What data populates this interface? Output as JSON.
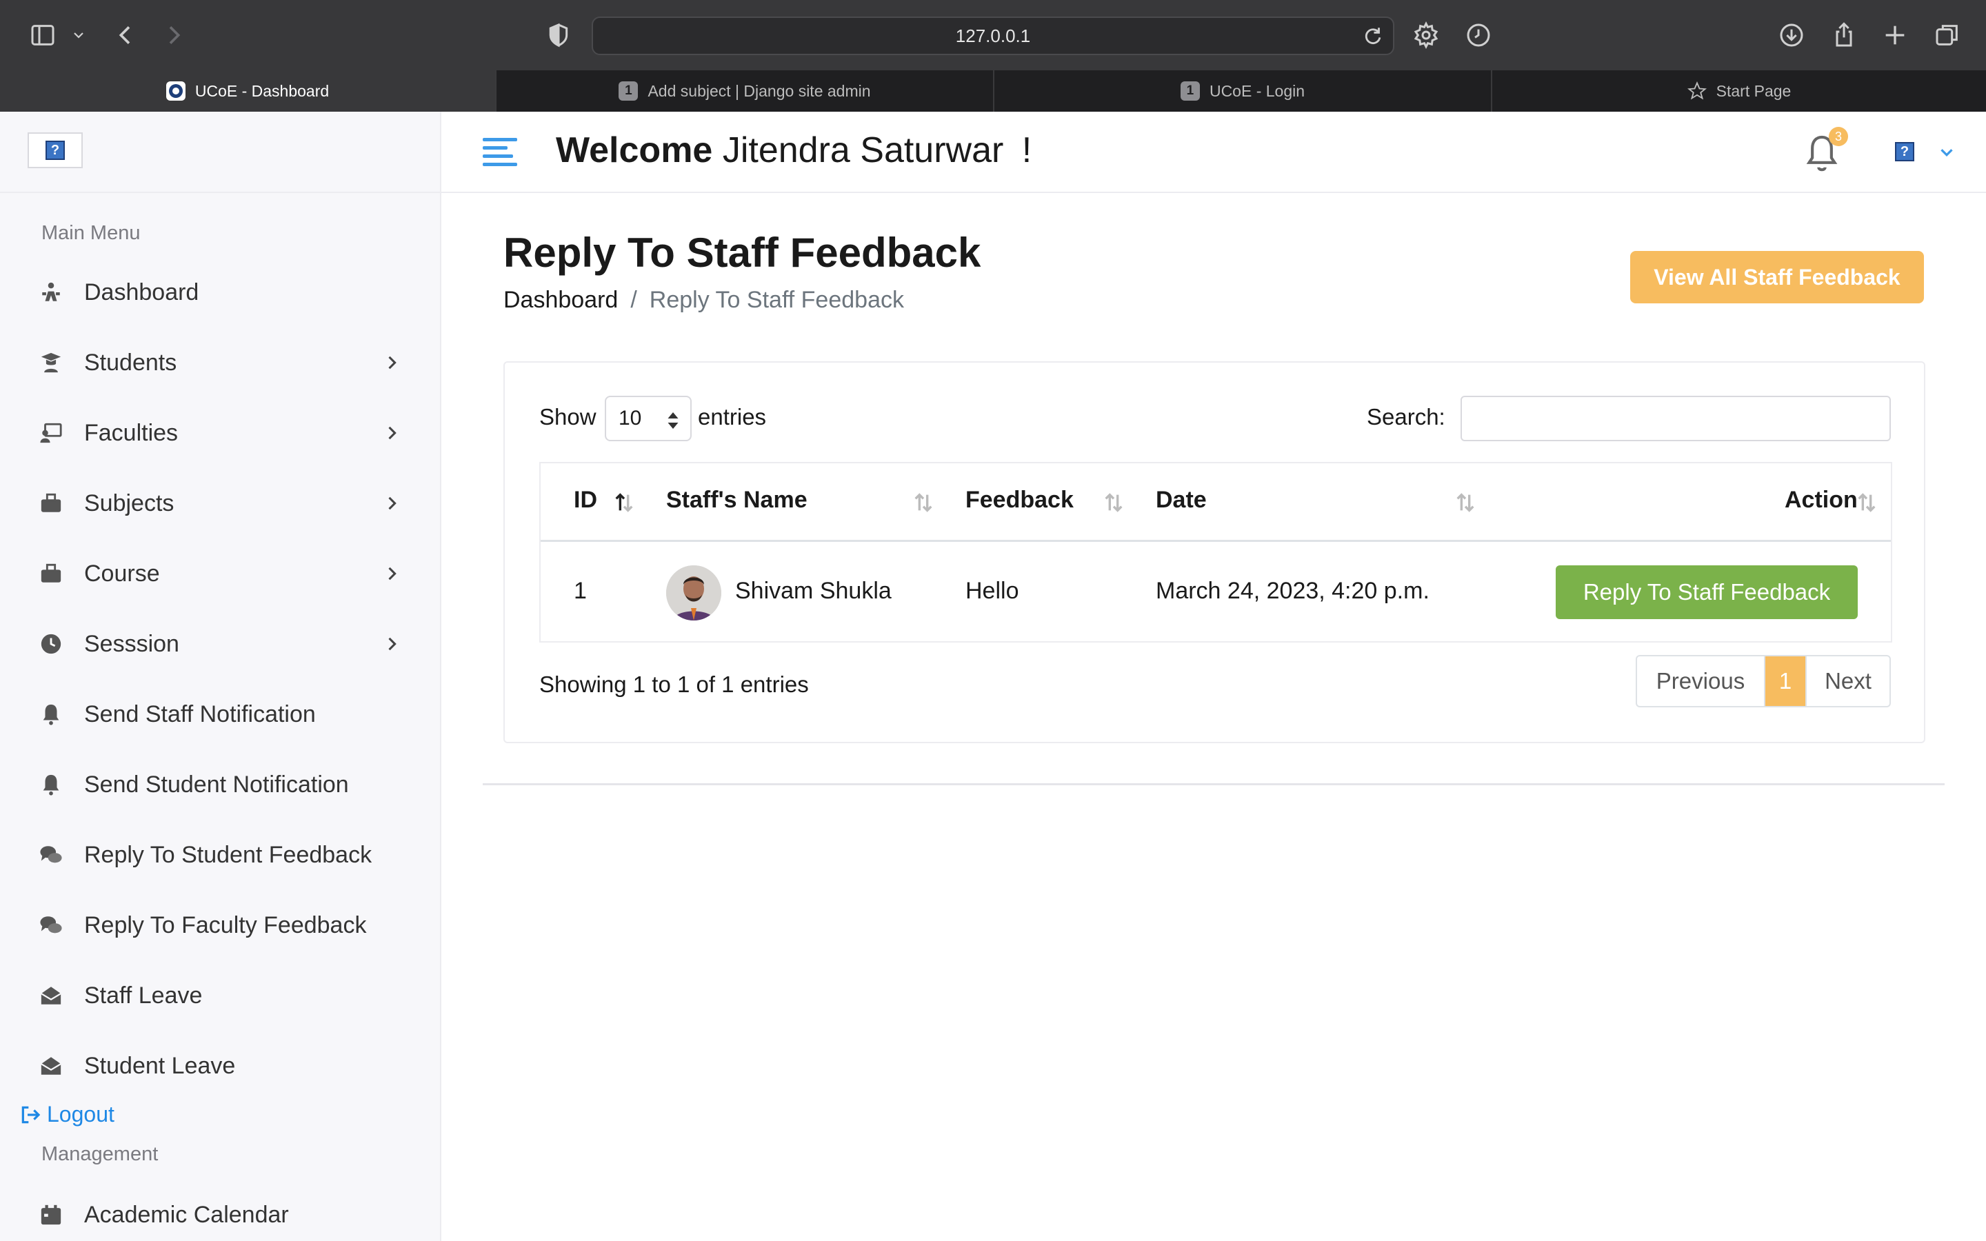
{
  "browser": {
    "url": "127.0.0.1",
    "tabs": [
      {
        "label": "UCoE - Dashboard",
        "icon": "college-logo-icon",
        "active": true
      },
      {
        "label": "Add subject | Django site admin",
        "icon_text": "1",
        "active": false
      },
      {
        "label": "UCoE - Login",
        "icon_text": "1",
        "active": false
      },
      {
        "label": "Start Page",
        "icon": "star-icon",
        "active": false
      }
    ]
  },
  "sidebar": {
    "logo_text": "?",
    "main_menu_title": "Main Menu",
    "items": [
      {
        "label": "Dashboard",
        "icon": "dashboard-icon",
        "has_submenu": false
      },
      {
        "label": "Students",
        "icon": "student-icon",
        "has_submenu": true
      },
      {
        "label": "Faculties",
        "icon": "faculty-icon",
        "has_submenu": true
      },
      {
        "label": "Subjects",
        "icon": "subjects-icon",
        "has_submenu": true
      },
      {
        "label": "Course",
        "icon": "course-icon",
        "has_submenu": true
      },
      {
        "label": "Sesssion",
        "icon": "clock-icon",
        "has_submenu": true
      },
      {
        "label": "Send Staff Notification",
        "icon": "bell-icon",
        "has_submenu": false
      },
      {
        "label": "Send Student Notification",
        "icon": "bell-icon",
        "has_submenu": false
      },
      {
        "label": "Reply To Student Feedback",
        "icon": "comments-icon",
        "has_submenu": false
      },
      {
        "label": "Reply To Faculty Feedback",
        "icon": "comments-icon",
        "has_submenu": false
      },
      {
        "label": "Staff Leave",
        "icon": "envelope-open-icon",
        "has_submenu": false
      },
      {
        "label": "Student Leave",
        "icon": "envelope-open-icon",
        "has_submenu": false
      }
    ],
    "logout_label": "Logout",
    "management_title": "Management",
    "management_items": [
      {
        "label": "Academic Calendar",
        "icon": "calendar-icon"
      }
    ]
  },
  "header": {
    "welcome_bold": "Welcome",
    "user_name": "Jitendra Saturwar",
    "exclamation": "!",
    "notification_count": "3",
    "avatar_text": "?"
  },
  "page": {
    "title": "Reply To Staff Feedback",
    "breadcrumb_home": "Dashboard",
    "breadcrumb_sep": "/",
    "breadcrumb_current": "Reply To Staff Feedback",
    "view_all_button": "View All Staff Feedback"
  },
  "table": {
    "show_label": "Show",
    "entries_value": "10",
    "entries_label": "entries",
    "search_label": "Search:",
    "search_value": "",
    "columns": [
      "ID",
      "Staff's Name",
      "Feedback",
      "Date",
      "Action"
    ],
    "rows": [
      {
        "id": "1",
        "staff_name": "Shivam Shukla",
        "feedback": "Hello",
        "date": "March 24, 2023, 4:20 p.m.",
        "action_label": "Reply To Staff Feedback"
      }
    ],
    "info": "Showing 1 to 1 of 1 entries",
    "pagination": {
      "previous": "Previous",
      "current": "1",
      "next": "Next"
    }
  },
  "colors": {
    "accent_orange": "#f7bc5f",
    "action_green": "#7bb24a",
    "link_blue": "#1e88e5",
    "menu_blue": "#3d9ae8"
  }
}
